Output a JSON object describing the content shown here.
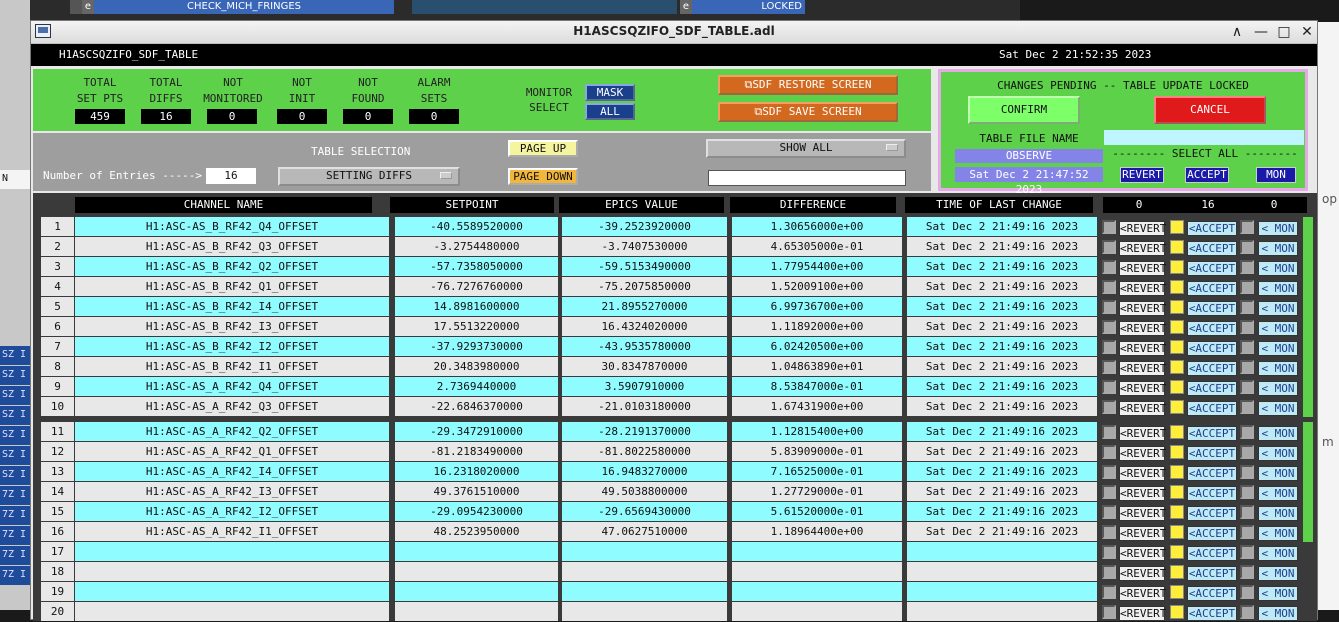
{
  "background": {
    "top_buttons": [
      "CHECK_MICH_FRINGES",
      "LOCKED"
    ],
    "e_label": "e",
    "left_labels": [
      "N",
      "SZ I",
      "SZ I",
      "SZ I",
      "SZ I",
      "SZ I",
      "SZ I",
      "SZ I",
      "7Z I",
      "7Z I",
      "7Z I",
      "7Z I",
      "7Z I"
    ],
    "right_labels": [
      "op",
      "m"
    ]
  },
  "window": {
    "title": "H1ASCSQZIFO_SDF_TABLE.adl",
    "controls": [
      "∧",
      "—",
      "□",
      "✕"
    ]
  },
  "header": {
    "screen_name": "H1ASCSQZIFO_SDF_TABLE",
    "datetime": "Sat Dec  2 21:52:35 2023"
  },
  "stats": [
    {
      "label1": "TOTAL",
      "label2": "SET PTS",
      "value": "459"
    },
    {
      "label1": "TOTAL",
      "label2": "DIFFS",
      "value": "16"
    },
    {
      "label1": "NOT",
      "label2": "MONITORED",
      "value": "0"
    },
    {
      "label1": "NOT",
      "label2": "INIT",
      "value": "0"
    },
    {
      "label1": "NOT",
      "label2": "FOUND",
      "value": "0"
    },
    {
      "label1": "ALARM",
      "label2": "SETS",
      "value": "0"
    }
  ],
  "monitor": {
    "label1": "MONITOR",
    "label2": "SELECT",
    "mask": "MASK",
    "all": "ALL"
  },
  "sdf_restore": "SDF RESTORE SCREEN",
  "sdf_save": "SDF SAVE SCREEN",
  "pending": {
    "title": "CHANGES PENDING -- TABLE UPDATE LOCKED",
    "confirm": "CONFIRM",
    "cancel": "CANCEL",
    "table_file_label": "TABLE FILE NAME",
    "table_file_value": "",
    "observe": "OBSERVE",
    "file_time": "Sat Dec  2 21:47:52 2023",
    "select_all": "-------- SELECT ALL --------",
    "revert": "REVERT",
    "accept": "ACCEPT",
    "mon": "MON"
  },
  "controls": {
    "entries_label": "Number of Entries ----->",
    "entries_value": "16",
    "table_selection_label": "TABLE SELECTION",
    "table_selection_value": "SETTING DIFFS",
    "page_up": "PAGE UP",
    "page_down": "PAGE DOWN",
    "show_value": "SHOW ALL",
    "search_value": ""
  },
  "table": {
    "headers": [
      "CHANNEL NAME",
      "SETPOINT",
      "EPICS VALUE",
      "DIFFERENCE",
      "TIME OF LAST CHANGE"
    ],
    "counts": [
      "0",
      "16",
      "0"
    ],
    "revert_label": "<REVERT",
    "accept_label": "<ACCEPT",
    "mon_label": "< MON",
    "rows": [
      {
        "n": "1",
        "channel": "H1:ASC-AS_B_RF42_Q4_OFFSET",
        "setpoint": "-40.5589520000",
        "epics": "-39.2523920000",
        "diff": "1.30656000e+00",
        "time": "Sat Dec  2 21:49:16 2023"
      },
      {
        "n": "2",
        "channel": "H1:ASC-AS_B_RF42_Q3_OFFSET",
        "setpoint": "-3.2754480000",
        "epics": "-3.7407530000",
        "diff": "4.65305000e-01",
        "time": "Sat Dec  2 21:49:16 2023"
      },
      {
        "n": "3",
        "channel": "H1:ASC-AS_B_RF42_Q2_OFFSET",
        "setpoint": "-57.7358050000",
        "epics": "-59.5153490000",
        "diff": "1.77954400e+00",
        "time": "Sat Dec  2 21:49:16 2023"
      },
      {
        "n": "4",
        "channel": "H1:ASC-AS_B_RF42_Q1_OFFSET",
        "setpoint": "-76.7276760000",
        "epics": "-75.2075850000",
        "diff": "1.52009100e+00",
        "time": "Sat Dec  2 21:49:16 2023"
      },
      {
        "n": "5",
        "channel": "H1:ASC-AS_B_RF42_I4_OFFSET",
        "setpoint": "14.8981600000",
        "epics": "21.8955270000",
        "diff": "6.99736700e+00",
        "time": "Sat Dec  2 21:49:16 2023"
      },
      {
        "n": "6",
        "channel": "H1:ASC-AS_B_RF42_I3_OFFSET",
        "setpoint": "17.5513220000",
        "epics": "16.4324020000",
        "diff": "1.11892000e+00",
        "time": "Sat Dec  2 21:49:16 2023"
      },
      {
        "n": "7",
        "channel": "H1:ASC-AS_B_RF42_I2_OFFSET",
        "setpoint": "-37.9293730000",
        "epics": "-43.9535780000",
        "diff": "6.02420500e+00",
        "time": "Sat Dec  2 21:49:16 2023"
      },
      {
        "n": "8",
        "channel": "H1:ASC-AS_B_RF42_I1_OFFSET",
        "setpoint": "20.3483980000",
        "epics": "30.8347870000",
        "diff": "1.04863890e+01",
        "time": "Sat Dec  2 21:49:16 2023"
      },
      {
        "n": "9",
        "channel": "H1:ASC-AS_A_RF42_Q4_OFFSET",
        "setpoint": "2.7369440000",
        "epics": "3.5907910000",
        "diff": "8.53847000e-01",
        "time": "Sat Dec  2 21:49:16 2023"
      },
      {
        "n": "10",
        "channel": "H1:ASC-AS_A_RF42_Q3_OFFSET",
        "setpoint": "-22.6846370000",
        "epics": "-21.0103180000",
        "diff": "1.67431900e+00",
        "time": "Sat Dec  2 21:49:16 2023"
      },
      {
        "n": "11",
        "channel": "H1:ASC-AS_A_RF42_Q2_OFFSET",
        "setpoint": "-29.3472910000",
        "epics": "-28.2191370000",
        "diff": "1.12815400e+00",
        "time": "Sat Dec  2 21:49:16 2023"
      },
      {
        "n": "12",
        "channel": "H1:ASC-AS_A_RF42_Q1_OFFSET",
        "setpoint": "-81.2183490000",
        "epics": "-81.8022580000",
        "diff": "5.83909000e-01",
        "time": "Sat Dec  2 21:49:16 2023"
      },
      {
        "n": "13",
        "channel": "H1:ASC-AS_A_RF42_I4_OFFSET",
        "setpoint": "16.2318020000",
        "epics": "16.9483270000",
        "diff": "7.16525000e-01",
        "time": "Sat Dec  2 21:49:16 2023"
      },
      {
        "n": "14",
        "channel": "H1:ASC-AS_A_RF42_I3_OFFSET",
        "setpoint": "49.3761510000",
        "epics": "49.5038800000",
        "diff": "1.27729000e-01",
        "time": "Sat Dec  2 21:49:16 2023"
      },
      {
        "n": "15",
        "channel": "H1:ASC-AS_A_RF42_I2_OFFSET",
        "setpoint": "-29.0954230000",
        "epics": "-29.6569430000",
        "diff": "5.61520000e-01",
        "time": "Sat Dec  2 21:49:16 2023"
      },
      {
        "n": "16",
        "channel": "H1:ASC-AS_A_RF42_I1_OFFSET",
        "setpoint": "48.2523950000",
        "epics": "47.0627510000",
        "diff": "1.18964400e+00",
        "time": "Sat Dec  2 21:49:16 2023"
      },
      {
        "n": "17",
        "channel": "",
        "setpoint": "",
        "epics": "",
        "diff": "",
        "time": ""
      },
      {
        "n": "18",
        "channel": "",
        "setpoint": "",
        "epics": "",
        "diff": "",
        "time": ""
      },
      {
        "n": "19",
        "channel": "",
        "setpoint": "",
        "epics": "",
        "diff": "",
        "time": ""
      },
      {
        "n": "20",
        "channel": "",
        "setpoint": "",
        "epics": "",
        "diff": "",
        "time": ""
      }
    ]
  }
}
